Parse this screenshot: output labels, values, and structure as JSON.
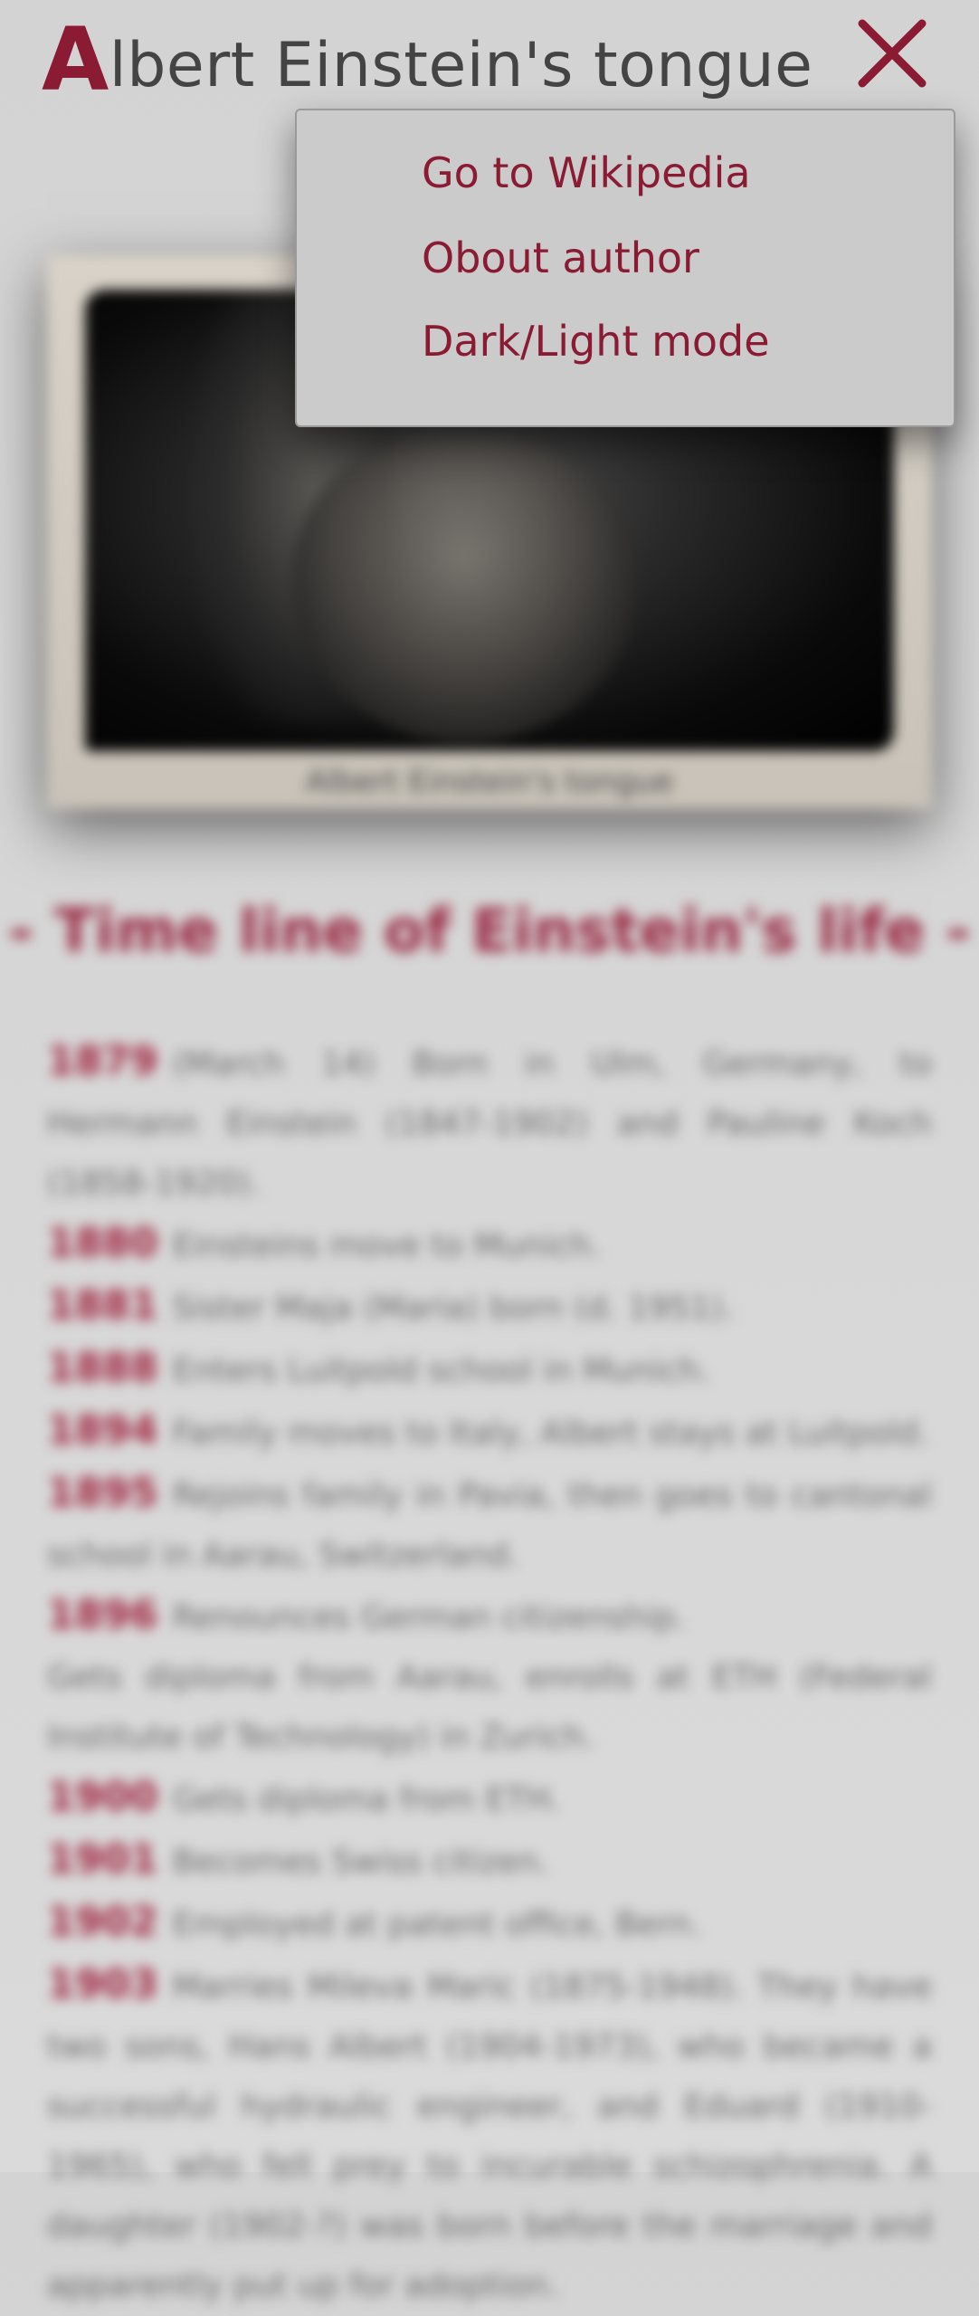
{
  "header": {
    "title_first_letter": "A",
    "title_rest": "lbert Einstein's tongue",
    "close_icon": "close-icon"
  },
  "menu": {
    "items": [
      {
        "label": "Go to Wikipedia"
      },
      {
        "label": "Obout author"
      },
      {
        "label": "Dark/Light mode"
      }
    ]
  },
  "content": {
    "photo_caption": "Albert Einstein's tongue",
    "section_title": "- Time line of Einstein's life -",
    "timeline": [
      {
        "year": "1879",
        "text": "(March 14) Born in Ulm, Germany, to Hermann Einstein (1847-1902) and Pauline Koch (1858-1920)."
      },
      {
        "year": "1880",
        "text": "Einsteins move to Munich."
      },
      {
        "year": "1881",
        "text": "Sister Maja (Maria) born (d. 1951)."
      },
      {
        "year": "1888",
        "text": "Enters Luitpold school in Munich."
      },
      {
        "year": "1894",
        "text": "Family moves to Italy, Albert stays at Luitpold."
      },
      {
        "year": "1895",
        "text": "Rejoins family in Pavia, then goes to cantonal school in Aarau, Switzerland."
      },
      {
        "year": "1896",
        "text": "Renounces German citizenship."
      },
      {
        "year": "",
        "text": "Gets diploma from Aarau, enrolls at ETH (Federal Institute of Technology) in Zurich."
      },
      {
        "year": "1900",
        "text": "Gets diploma from ETH."
      },
      {
        "year": "1901",
        "text": "Becomes Swiss citizen."
      },
      {
        "year": "1902",
        "text": "Employed at patent office, Bern."
      },
      {
        "year": "1903",
        "text": "Marries Mileva Maric (1875-1948). They have two sons, Hans Albert (1904-1973), who became a successful hydraulic engineer, and Eduard (1910-1965), who fell prey to incurable schizophrenia. A daughter (1902-?) was born before the marriage and apparently put up for adoption."
      }
    ]
  },
  "colors": {
    "accent": "#8b1a33",
    "background": "#d3d3d3",
    "menu_background": "#cbcbcb",
    "title_text": "#444444"
  }
}
